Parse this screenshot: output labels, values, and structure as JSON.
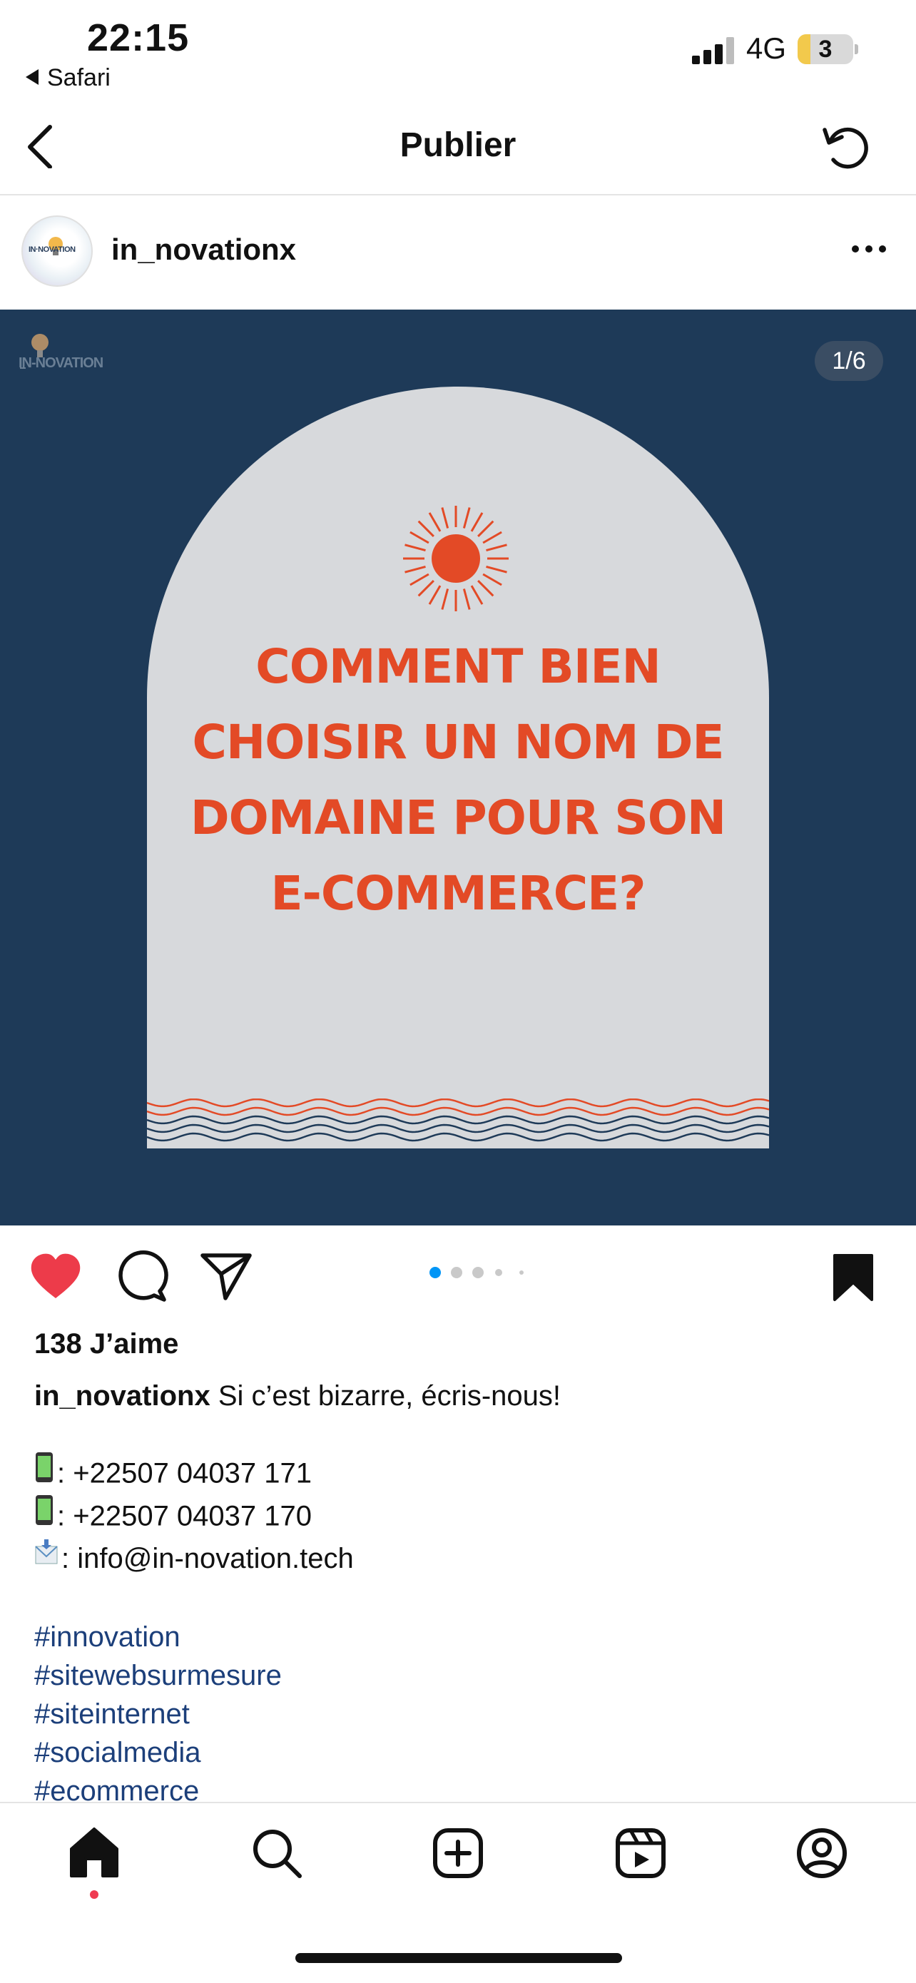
{
  "status": {
    "time": "22:15",
    "back_app": "Safari",
    "network": "4G",
    "battery": "3"
  },
  "nav": {
    "title": "Publier"
  },
  "post": {
    "username": "in_novationx",
    "image_counter": "1/6",
    "image_headline": [
      "COMMENT BIEN",
      "CHOISIR UN NOM DE",
      "DOMAINE POUR SON",
      "E-COMMERCE?"
    ],
    "logo_text": "IN-NOVATION",
    "likes": "138 J’aime",
    "caption_user": "in_novationx",
    "caption_text": "Si c’est bizarre, écris-nous!",
    "phone1": ": +22507 04037 171",
    "phone2": ": +22507 04037 170",
    "email": ": info@in-novation.tech",
    "hashtags": [
      "#innovation",
      "#sitewebsurmesure",
      "#siteinternet",
      "#socialmedia",
      "#ecommerce"
    ],
    "carousel": {
      "total": 6,
      "current": 1
    }
  },
  "colors": {
    "image_bg": "#1e3a58",
    "headline": "#e34a26",
    "like": "#ed3b4a",
    "hashtag": "#1c3f7a",
    "active_dot": "#0095f6"
  },
  "icons": [
    "back-icon",
    "refresh-icon",
    "more-icon",
    "heart-icon",
    "comment-icon",
    "share-icon",
    "bookmark-icon",
    "home-icon",
    "search-icon",
    "create-icon",
    "reels-icon",
    "profile-icon"
  ]
}
